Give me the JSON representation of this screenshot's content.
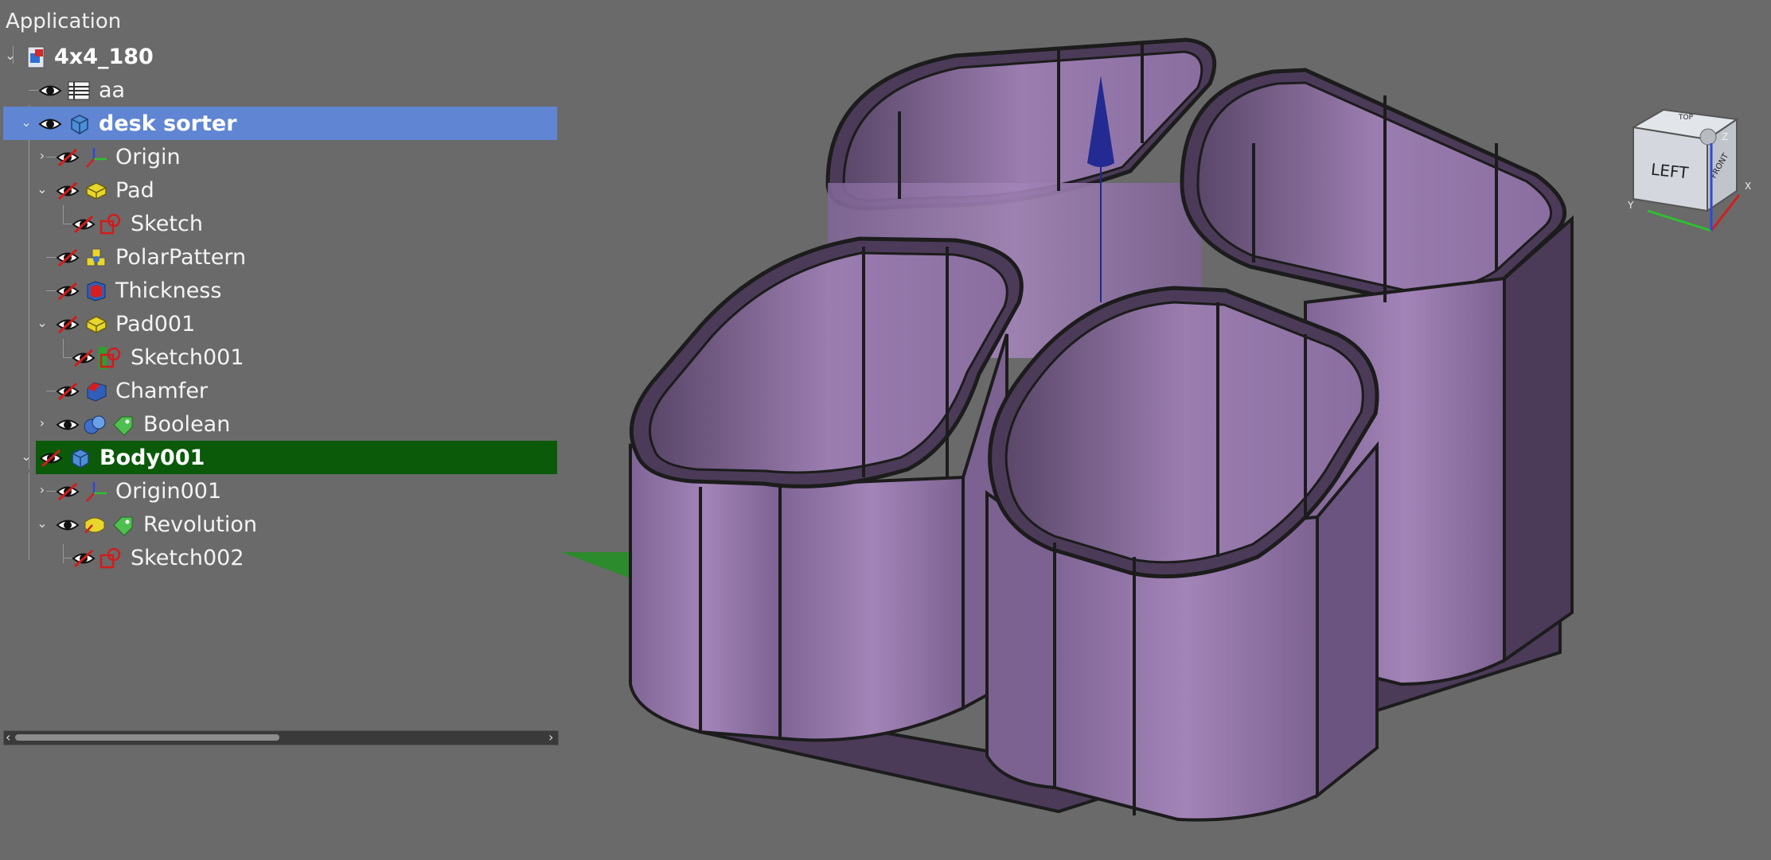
{
  "tree": {
    "header": "Application",
    "rows": [
      {
        "label": "4x4_180",
        "bold": true
      },
      {
        "label": "aa",
        "bold": false
      },
      {
        "label": "desk sorter",
        "bold": true
      },
      {
        "label": "Origin",
        "bold": false
      },
      {
        "label": "Pad",
        "bold": false
      },
      {
        "label": "Sketch",
        "bold": false
      },
      {
        "label": "PolarPattern",
        "bold": false
      },
      {
        "label": "Thickness",
        "bold": false
      },
      {
        "label": "Pad001",
        "bold": false
      },
      {
        "label": "Sketch001",
        "bold": false
      },
      {
        "label": "Chamfer",
        "bold": false
      },
      {
        "label": "Boolean",
        "bold": false
      },
      {
        "label": "Body001",
        "bold": true
      },
      {
        "label": "Origin001",
        "bold": false
      },
      {
        "label": "Revolution",
        "bold": false
      },
      {
        "label": "Sketch002",
        "bold": false
      }
    ]
  },
  "navcube": {
    "face_left": "LEFT",
    "face_right": "FRONT",
    "face_top": "TOP",
    "axis_x": "X",
    "axis_y": "Y",
    "axis_z": "Z"
  },
  "colors": {
    "background": "#6a6a6a",
    "selection_blue": "#5f85d3",
    "selection_green": "#0a5a0a",
    "model_face": "#9378a8",
    "model_dark": "#4b3b58",
    "edge": "#1c1c1c"
  }
}
